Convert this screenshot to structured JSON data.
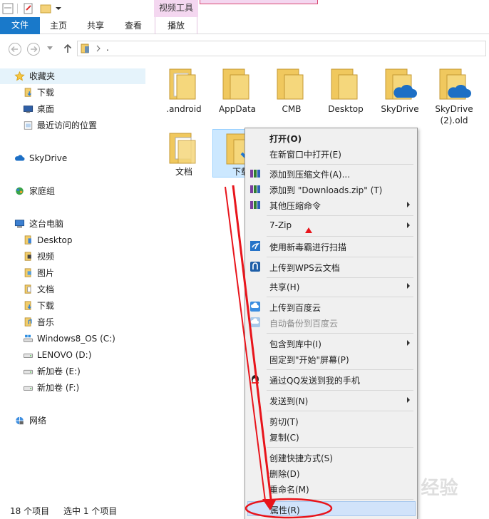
{
  "ribbon": {
    "contextual_label": "视频工具",
    "tabs": [
      {
        "label": "文件"
      },
      {
        "label": "主页"
      },
      {
        "label": "共享"
      },
      {
        "label": "查看"
      },
      {
        "label": "播放"
      }
    ]
  },
  "address": {
    "path": "."
  },
  "sidebar": {
    "favorites": "收藏夹",
    "fav_items": [
      "下载",
      "桌面",
      "最近访问的位置"
    ],
    "skydrive": "SkyDrive",
    "homegroup": "家庭组",
    "pc": "这台电脑",
    "pc_items": [
      "Desktop",
      "视频",
      "图片",
      "文档",
      "下载",
      "音乐",
      "Windows8_OS (C:)",
      "LENOVO (D:)",
      "新加卷 (E:)",
      "新加卷 (F:)"
    ],
    "network": "网络"
  },
  "files": [
    ".android",
    "AppData",
    "CMB",
    "Desktop",
    "SkyDrive",
    "SkyDrive (2).old",
    "文档",
    "下载"
  ],
  "context_menu": {
    "items": [
      "打开(O)",
      "在新窗口中打开(E)",
      "添加到压缩文件(A)...",
      "添加到 \"Downloads.zip\" (T)",
      "其他压缩命令",
      "7-Zip",
      "使用新毒霸进行扫描",
      "上传到WPS云文档",
      "共享(H)",
      "上传到百度云",
      "自动备份到百度云",
      "包含到库中(I)",
      "固定到\"开始\"屏幕(P)",
      "通过QQ发送到我的手机",
      "发送到(N)",
      "剪切(T)",
      "复制(C)",
      "创建快捷方式(S)",
      "删除(D)",
      "重命名(M)",
      "属性(R)"
    ]
  },
  "status": {
    "count": "18 个项目",
    "selected": "选中 1 个项目"
  },
  "watermark": "Baidu 经验",
  "colors": {
    "file_tab": "#1979ca",
    "annotation": "#e8141b",
    "selection": "#cce8ff",
    "context_tab": "#f4d7f0"
  }
}
